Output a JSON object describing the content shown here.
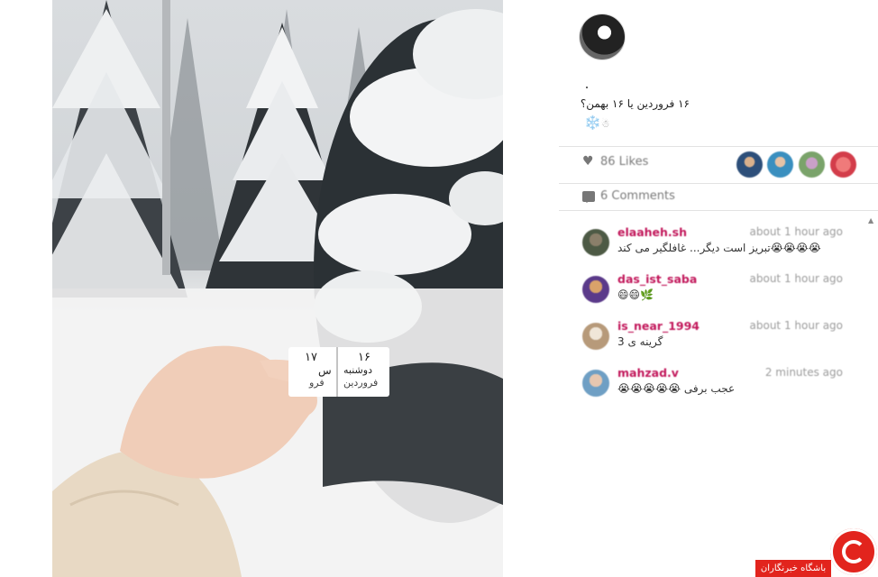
{
  "post": {
    "caption_line1": "۱۶ فروردین یا ۱۶ بهمن؟",
    "caption_emoji": "❄️",
    "caption_extra": "☃︎",
    "likes_label": "86 Likes",
    "comments_label": "6 Comments"
  },
  "photo": {
    "ticket_left_number": "۱۷",
    "ticket_left_text": "س",
    "ticket_left_month": "فرو",
    "ticket_right_number": "۱۶",
    "ticket_right_day": "دوشنبه",
    "ticket_right_month": "فروردین"
  },
  "comments": [
    {
      "user": "elaaheh.sh",
      "time": "about 1 hour ago",
      "text": "😭😭😭😭تبریز است دیگر... غافلگیر می کند"
    },
    {
      "user": "das_ist_saba",
      "time": "about 1 hour ago",
      "text": "😄😄🌿"
    },
    {
      "user": "is_near_1994",
      "time": "about 1 hour ago",
      "text": "گرینه ی 3"
    },
    {
      "user": "mahzad.v",
      "time": "2 minutes ago",
      "text": "عجب برفی 😭😭😭😭😭"
    }
  ],
  "badge": {
    "text": "باشگاه خبرنگاران"
  },
  "colors": {
    "username": "#c2185b",
    "badge": "#e2241d"
  },
  "icons": [
    "heart-icon",
    "comment-icon",
    "scroll-up-icon"
  ]
}
